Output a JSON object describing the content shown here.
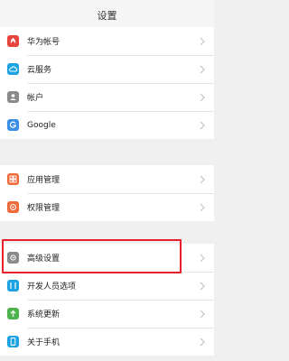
{
  "header": {
    "title": "设置"
  },
  "group1": [
    {
      "label": "华为帐号",
      "icon": "huawei-account-icon",
      "color": "#e8453c"
    },
    {
      "label": "云服务",
      "icon": "cloud-icon",
      "color": "#1aa3e0"
    },
    {
      "label": "帐户",
      "icon": "account-icon",
      "color": "#8a8a8a"
    },
    {
      "label": "Google",
      "icon": "google-icon",
      "color": "#3b8ee5"
    }
  ],
  "group2": [
    {
      "label": "应用管理",
      "icon": "app-manager-icon",
      "color": "#f06a3a"
    },
    {
      "label": "权限管理",
      "icon": "permission-icon",
      "color": "#f06a3a"
    }
  ],
  "group3": [
    {
      "label": "高级设置",
      "icon": "gear-icon",
      "color": "#8a8a8a"
    },
    {
      "label": "开发人员选项",
      "icon": "developer-icon",
      "color": "#1aa3e0"
    },
    {
      "label": "系统更新",
      "icon": "update-icon",
      "color": "#4db34d"
    },
    {
      "label": "关于手机",
      "icon": "phone-icon",
      "color": "#1aa3e0"
    }
  ],
  "highlight_color": "#e8202a"
}
